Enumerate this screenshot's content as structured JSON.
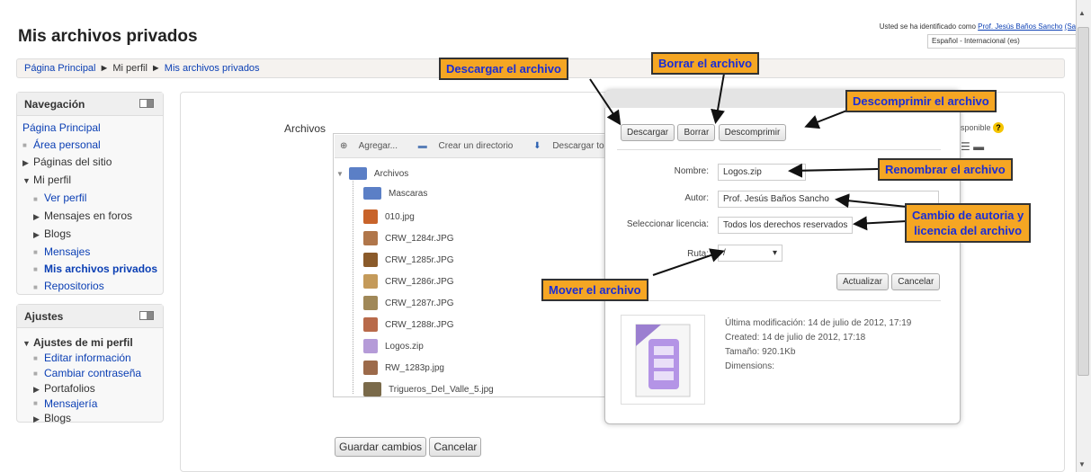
{
  "header": {
    "page_title": "Mis archivos privados",
    "login_prefix": "Usted se ha identificado como",
    "user_name": "Prof. Jesús Baños Sancho",
    "logout": "(Salir)",
    "language": "Español - Internacional (es)"
  },
  "breadcrumb": {
    "items": [
      "Página Principal",
      "Mi perfil",
      "Mis archivos privados"
    ],
    "separator": "►"
  },
  "navigation": {
    "title": "Navegación",
    "items": [
      {
        "label": "Página Principal"
      },
      {
        "label": "Área personal"
      },
      {
        "label": "Páginas del sitio"
      },
      {
        "label": "Mi perfil"
      },
      {
        "label": "Ver perfil"
      },
      {
        "label": "Mensajes en foros"
      },
      {
        "label": "Blogs"
      },
      {
        "label": "Mensajes"
      },
      {
        "label": "Mis archivos privados"
      },
      {
        "label": "Repositorios"
      }
    ]
  },
  "settings": {
    "title": "Ajustes",
    "items": [
      {
        "label": "Ajustes de mi perfil"
      },
      {
        "label": "Editar información"
      },
      {
        "label": "Cambiar contraseña"
      },
      {
        "label": "Portafolios"
      },
      {
        "label": "Mensajería"
      },
      {
        "label": "Blogs"
      }
    ]
  },
  "filemanager": {
    "label": "Archivos",
    "toolbar": {
      "add": "Agregar...",
      "create_dir": "Crear un directorio",
      "download_all": "Descargar todo"
    },
    "root": "Archivos",
    "files": [
      {
        "name": "Mascaras"
      },
      {
        "name": "010.jpg"
      },
      {
        "name": "CRW_1284r.JPG"
      },
      {
        "name": "CRW_1285r.JPG"
      },
      {
        "name": "CRW_1286r.JPG"
      },
      {
        "name": "CRW_1287r.JPG"
      },
      {
        "name": "CRW_1288r.JPG"
      },
      {
        "name": "Logos.zip"
      },
      {
        "name": "RW_1283p.jpg"
      },
      {
        "name": "Trigueros_Del_Valle_5.jpg"
      }
    ],
    "save": "Guardar cambios",
    "cancel": "Cancelar",
    "peek_text": "sponible"
  },
  "dialog": {
    "buttons": {
      "download": "Descargar",
      "delete": "Borrar",
      "unzip": "Descomprimir"
    },
    "fields": {
      "name_label": "Nombre:",
      "name_value": "Logos.zip",
      "author_label": "Autor:",
      "author_value": "Prof. Jesús Baños Sancho",
      "license_label": "Seleccionar licencia:",
      "license_value": "Todos los derechos reservados",
      "path_label": "Ruta:",
      "path_value": "/"
    },
    "actions": {
      "update": "Actualizar",
      "cancel": "Cancelar"
    },
    "meta": {
      "modified": "Última modificación: 14 de julio de 2012, 17:19",
      "created": "Created: 14 de julio de 2012, 17:18",
      "size": "Tamaño: 920.1Kb",
      "dimensions": "Dimensions:"
    }
  },
  "callouts": {
    "download": "Descargar el archivo",
    "delete": "Borrar el archivo",
    "unzip": "Descomprimir el archivo",
    "rename": "Renombrar el archivo",
    "author_license_1": "Cambio de autoria y",
    "author_license_2": "licencia del archivo",
    "move": "Mover el archivo"
  },
  "colors": {
    "callout_bg": "#f5a623",
    "callout_text": "#1a2dd6",
    "link": "#0b3fb4"
  }
}
